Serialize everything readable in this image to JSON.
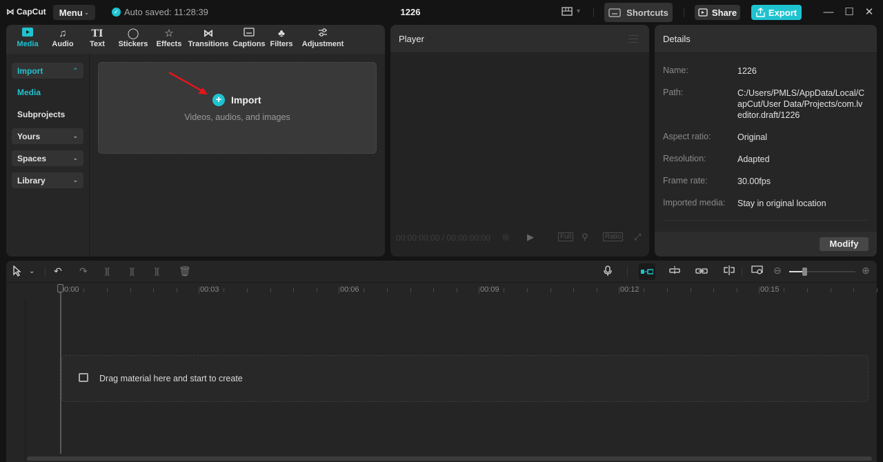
{
  "app": {
    "logo_text": "CapCut",
    "menu_label": "Menu",
    "autosave_text": "Auto saved: 11:28:39",
    "project_title": "1226",
    "shortcuts_label": "Shortcuts",
    "share_label": "Share",
    "export_label": "Export",
    "accent_color": "#1fc3d0"
  },
  "media_tabs": [
    {
      "label": "Media",
      "icon": "media-icon",
      "active": true
    },
    {
      "label": "Audio",
      "icon": "audio-icon"
    },
    {
      "label": "Text",
      "icon": "text-icon"
    },
    {
      "label": "Stickers",
      "icon": "stickers-icon"
    },
    {
      "label": "Effects",
      "icon": "effects-icon"
    },
    {
      "label": "Transitions",
      "icon": "transitions-icon"
    },
    {
      "label": "Captions",
      "icon": "captions-icon"
    },
    {
      "label": "Filters",
      "icon": "filters-icon"
    },
    {
      "label": "Adjustment",
      "icon": "adjustment-icon"
    }
  ],
  "media_sidebar": [
    {
      "label": "Import",
      "expanded": true
    },
    {
      "label": "Media",
      "active": true
    },
    {
      "label": "Subprojects"
    },
    {
      "label": "Yours"
    },
    {
      "label": "Spaces"
    },
    {
      "label": "Library"
    }
  ],
  "import_area": {
    "title": "Import",
    "subtitle": "Videos, audios, and images"
  },
  "player": {
    "title": "Player",
    "current_time": "00:00:00:00",
    "total_time": "00:00:00:00",
    "full_label": "Full",
    "ratio_label": "Ratio"
  },
  "details": {
    "title": "Details",
    "rows": [
      {
        "key": "Name:",
        "value": "1226"
      },
      {
        "key": "Path:",
        "value": "C:/Users/PMLS/AppData/Local/CapCut/User Data/Projects/com.lveditor.draft/1226"
      },
      {
        "key": "Aspect ratio:",
        "value": "Original"
      },
      {
        "key": "Resolution:",
        "value": "Adapted"
      },
      {
        "key": "Frame rate:",
        "value": "30.00fps"
      },
      {
        "key": "Imported media:",
        "value": "Stay in original location"
      }
    ],
    "modify_label": "Modify"
  },
  "timeline": {
    "ruler_labels": [
      "00:00",
      "00:03",
      "00:06",
      "00:09",
      "00:12",
      "00:15"
    ],
    "drop_text": "Drag material here and start to create",
    "zoom_level": 0.2
  }
}
